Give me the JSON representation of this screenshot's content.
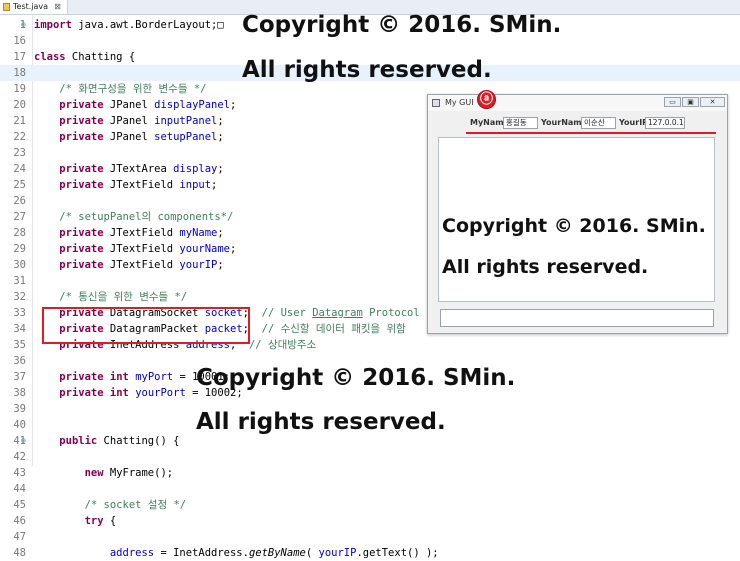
{
  "tab": {
    "label": "Test.java",
    "close": "⊠"
  },
  "lines": [
    {
      "n": "1",
      "code": "import java.awt.BorderLayout;□",
      "kind": "import",
      "fold": "⊕"
    },
    {
      "n": "16",
      "code": "",
      "kind": "blank"
    },
    {
      "n": "17",
      "code": "class Chatting {",
      "kind": "class"
    },
    {
      "n": "18",
      "code": "",
      "kind": "blank",
      "current": true
    },
    {
      "n": "19",
      "code": "    /* 화면구성을 위한 변수들 */",
      "kind": "comment"
    },
    {
      "n": "20",
      "code": "    private JPanel displayPanel;",
      "kind": "field",
      "type": "JPanel",
      "name": "displayPanel"
    },
    {
      "n": "21",
      "code": "    private JPanel inputPanel;",
      "kind": "field",
      "type": "JPanel",
      "name": "inputPanel"
    },
    {
      "n": "22",
      "code": "    private JPanel setupPanel;",
      "kind": "field",
      "type": "JPanel",
      "name": "setupPanel"
    },
    {
      "n": "23",
      "code": "",
      "kind": "blank"
    },
    {
      "n": "24",
      "code": "    private JTextArea display;",
      "kind": "field",
      "type": "JTextArea",
      "name": "display"
    },
    {
      "n": "25",
      "code": "    private JTextField input;",
      "kind": "field",
      "type": "JTextField",
      "name": "input"
    },
    {
      "n": "26",
      "code": "",
      "kind": "blank"
    },
    {
      "n": "27",
      "code": "    /* setupPanel의 components*/",
      "kind": "comment"
    },
    {
      "n": "28",
      "code": "    private JTextField myName;",
      "kind": "field",
      "type": "JTextField",
      "name": "myName"
    },
    {
      "n": "29",
      "code": "    private JTextField yourName;",
      "kind": "field",
      "type": "JTextField",
      "name": "yourName"
    },
    {
      "n": "30",
      "code": "    private JTextField yourIP;",
      "kind": "field",
      "type": "JTextField",
      "name": "yourIP"
    },
    {
      "n": "31",
      "code": "",
      "kind": "blank"
    },
    {
      "n": "32",
      "code": "    /* 통신을 위한 변수들 */",
      "kind": "comment"
    },
    {
      "n": "33",
      "code": "    private DatagramSocket socket;  // User Datagram Protocol",
      "kind": "field",
      "type": "DatagramSocket",
      "name": "socket",
      "trail": "  // User Datagram Protocol"
    },
    {
      "n": "34",
      "code": "    private DatagramPacket packet;  // 수신할 데이터 패킷을 위함",
      "kind": "field",
      "type": "DatagramPacket",
      "name": "packet",
      "trail": "  // 수신할 데이터 패킷을 위함"
    },
    {
      "n": "35",
      "code": "    private InetAddress address;  // 상대방주소",
      "kind": "field",
      "type": "InetAddress",
      "name": "address",
      "trail": "  // 상대방주소"
    },
    {
      "n": "36",
      "code": "",
      "kind": "blank"
    },
    {
      "n": "37",
      "code": "    private int myPort = 10001;",
      "kind": "intfield",
      "name": "myPort",
      "value": " = 10001;"
    },
    {
      "n": "38",
      "code": "    private int yourPort = 10002;",
      "kind": "intfield",
      "name": "yourPort",
      "value": " = 10002;"
    },
    {
      "n": "39",
      "code": "",
      "kind": "blank"
    },
    {
      "n": "40",
      "code": "",
      "kind": "blank"
    },
    {
      "n": "41",
      "code": "    public Chatting() {",
      "kind": "ctor",
      "fold": "⊖"
    },
    {
      "n": "42",
      "code": "",
      "kind": "blank"
    },
    {
      "n": "43",
      "code": "        new MyFrame();",
      "kind": "new"
    },
    {
      "n": "44",
      "code": "",
      "kind": "blank"
    },
    {
      "n": "45",
      "code": "        /* socket 설정 */",
      "kind": "comment"
    },
    {
      "n": "46",
      "code": "        try {",
      "kind": "try"
    },
    {
      "n": "47",
      "code": "",
      "kind": "blank"
    },
    {
      "n": "48",
      "code": "            address = InetAddress.getByName( yourIP.getText() );",
      "kind": "assign"
    }
  ],
  "watermark": {
    "line1": "Copyright © 2016. SMin.",
    "line2": "All rights reserved."
  },
  "gui": {
    "title": "My GUI",
    "badge": "ⓐ",
    "btn_min": "▭",
    "btn_max": "▣",
    "btn_close": "✕",
    "setup": {
      "myname_label": "MyName",
      "myname_value": "홍길동",
      "yourname_label": "YourName",
      "yourname_value": "이순신",
      "yourip_label": "YourIP",
      "yourip_value": "127.0.0.1"
    }
  },
  "colors": {
    "keyword": "#7f0055",
    "comment": "#3f7f5f",
    "field": "#0000c0",
    "highlight": "#d91e26"
  }
}
